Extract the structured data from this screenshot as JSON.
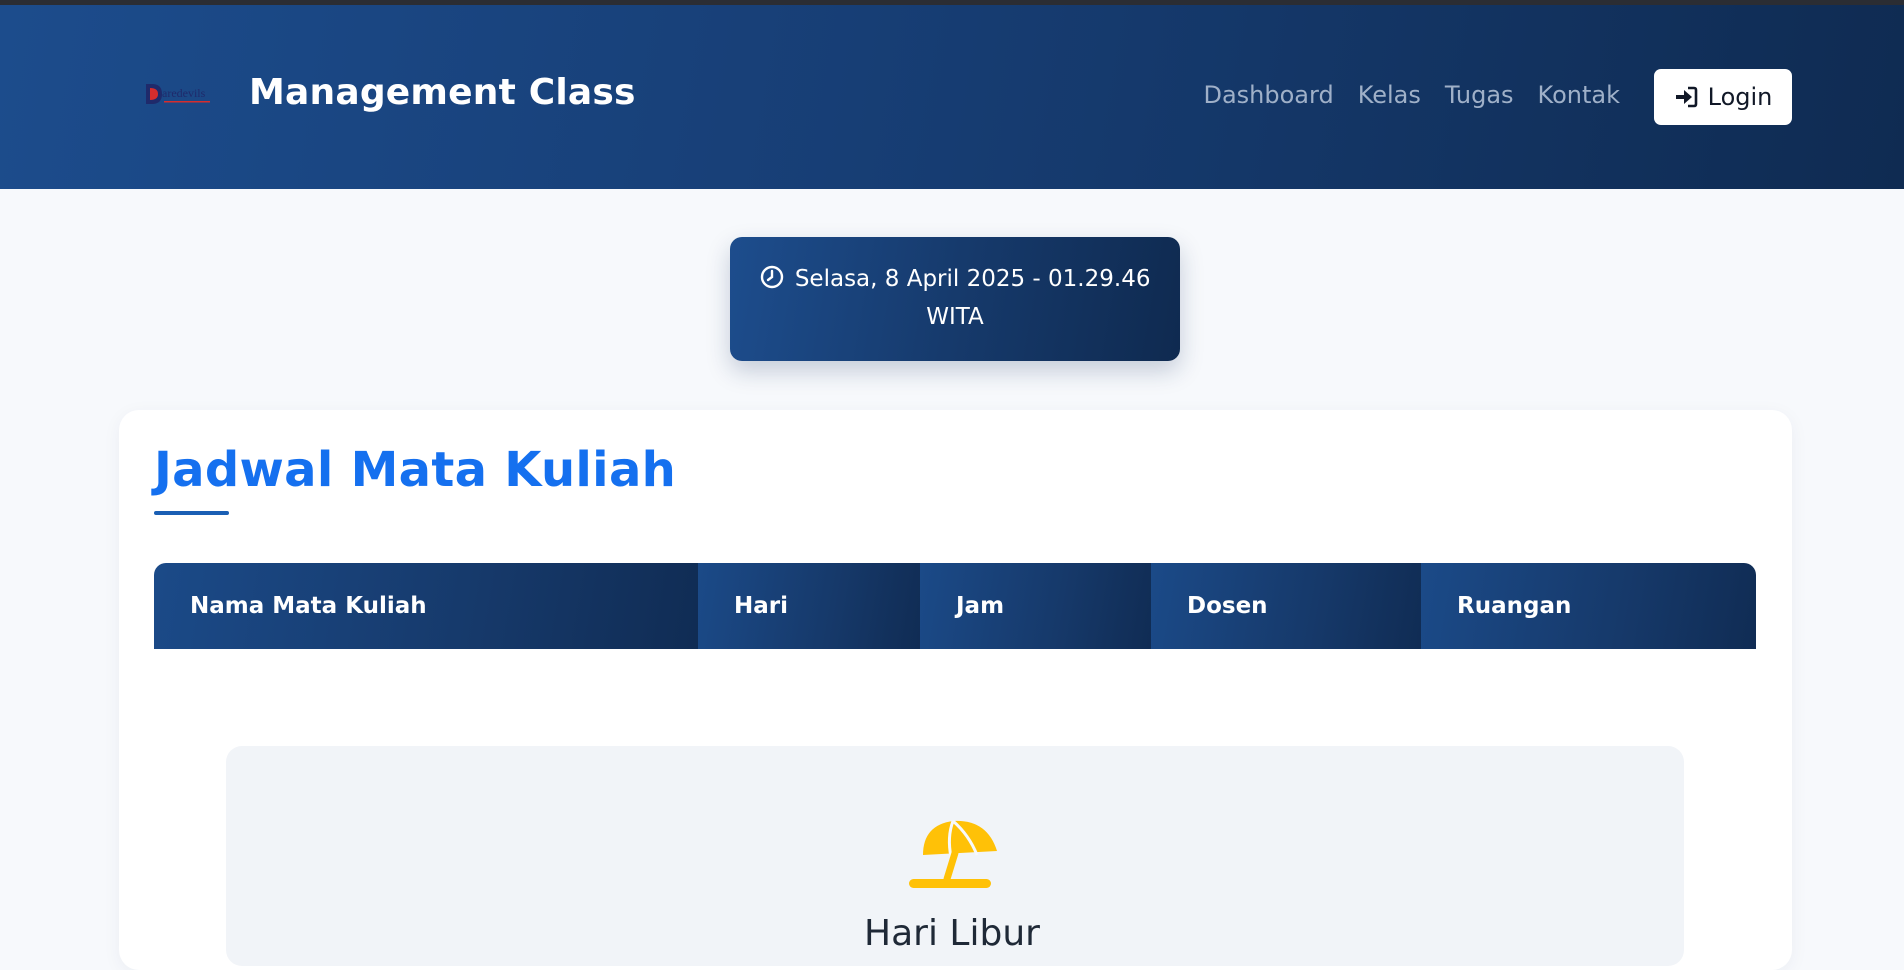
{
  "header": {
    "brand_title": "Management Class",
    "logo_icon": "daredevils-logo-icon",
    "nav": [
      "Dashboard",
      "Kelas",
      "Tugas",
      "Kontak"
    ],
    "login_label": "Login",
    "login_icon": "sign-in-icon"
  },
  "clock": {
    "icon": "clock-icon",
    "line1": "Selasa, 8 April 2025 - 01.29.46",
    "line2": "WITA"
  },
  "schedule": {
    "title": "Jadwal Mata Kuliah",
    "columns": [
      "Nama Mata Kuliah",
      "Hari",
      "Jam",
      "Dosen",
      "Ruangan"
    ],
    "empty_state": {
      "icon": "umbrella-beach-icon",
      "text": "Hari Libur"
    }
  },
  "colors": {
    "navbar_start": "#1c4c8c",
    "navbar_end": "#0f2b52",
    "title_blue": "#1570ef",
    "umbrella_yellow": "#ffc107",
    "page_bg": "#f7f9fc"
  }
}
